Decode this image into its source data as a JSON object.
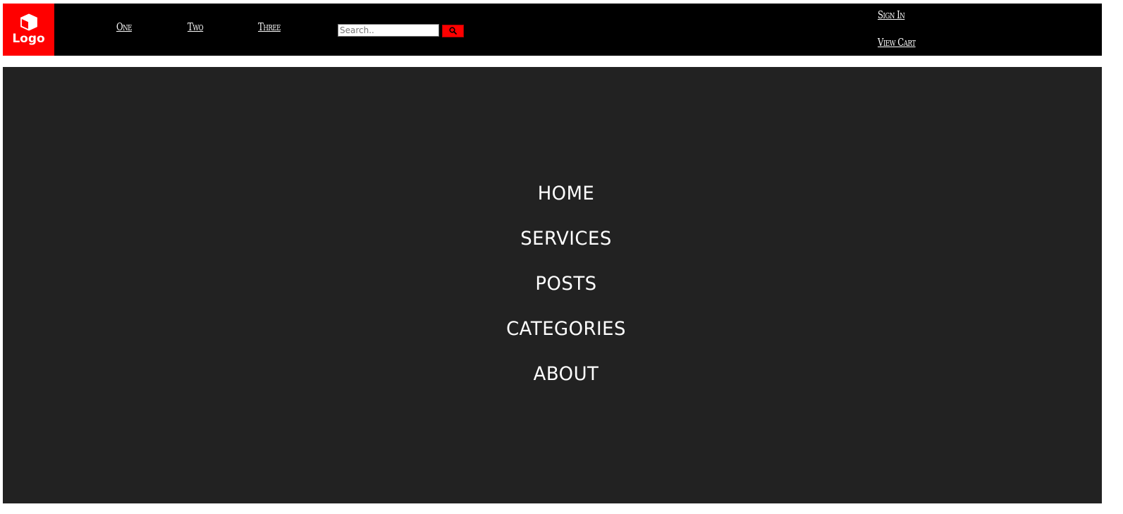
{
  "header": {
    "logo_label": "Logo",
    "logo_icon": "cube-icon",
    "nav": [
      {
        "label": "One"
      },
      {
        "label": "Two"
      },
      {
        "label": "Three"
      }
    ],
    "search": {
      "placeholder": "Search..",
      "button_icon": "search-icon"
    },
    "account": {
      "sign_in": "Sign In",
      "view_cart": "View Cart"
    }
  },
  "menu": {
    "items": [
      {
        "label": "HOME"
      },
      {
        "label": "SERVICES"
      },
      {
        "label": "POSTS"
      },
      {
        "label": "CATEGORIES"
      },
      {
        "label": "ABOUT"
      }
    ]
  },
  "colors": {
    "header_bg": "#000000",
    "logo_bg": "#ff0000",
    "main_bg": "#222222",
    "text": "#ffffff"
  }
}
